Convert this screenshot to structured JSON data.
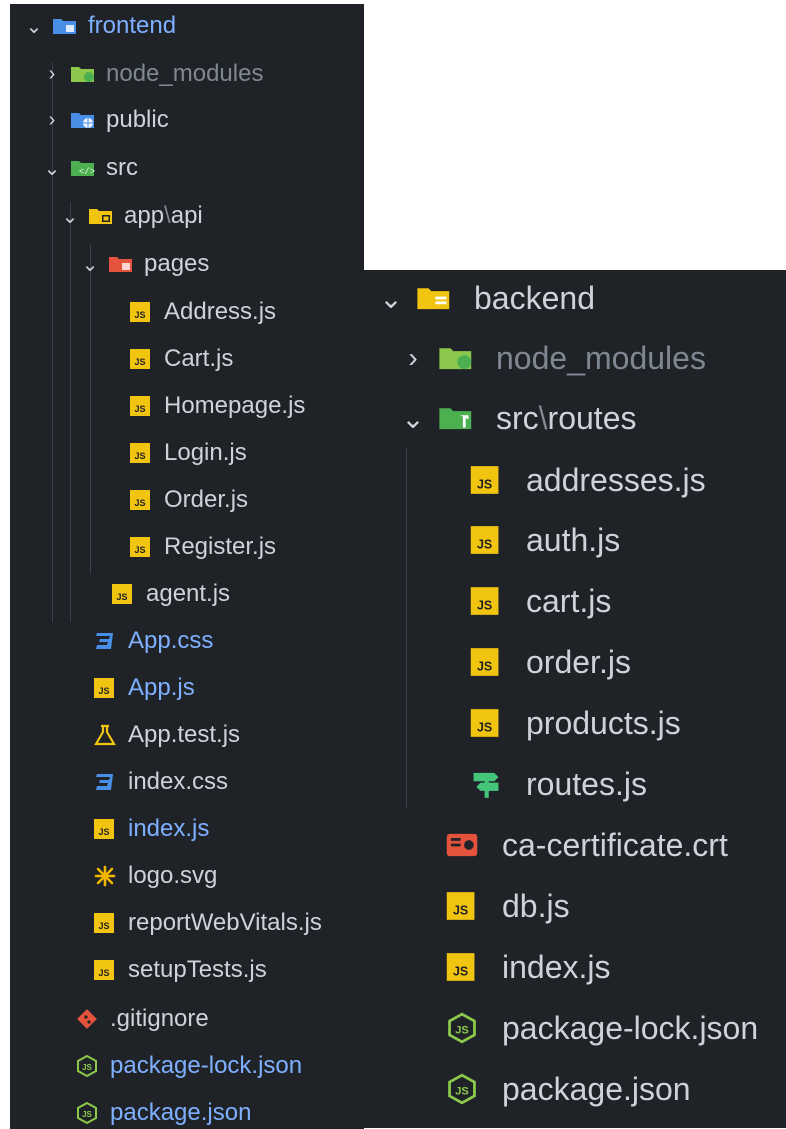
{
  "frontend": {
    "root": "frontend",
    "node_modules": "node_modules",
    "public": "public",
    "src": "src",
    "app_api": {
      "a": "app",
      "sep": "\\",
      "b": "api"
    },
    "pages": "pages",
    "page_files": [
      "Address.js",
      "Cart.js",
      "Homepage.js",
      "Login.js",
      "Order.js",
      "Register.js"
    ],
    "agent": "agent.js",
    "src_files": [
      "App.css",
      "App.js",
      "App.test.js",
      "index.css",
      "index.js",
      "logo.svg",
      "reportWebVitals.js",
      "setupTests.js"
    ],
    "root_files": [
      ".gitignore",
      "package-lock.json",
      "package.json"
    ]
  },
  "backend": {
    "root": "backend",
    "node_modules": "node_modules",
    "src_routes": {
      "a": "src",
      "sep": "\\",
      "b": "routes"
    },
    "route_files": [
      "addresses.js",
      "auth.js",
      "cart.js",
      "order.js",
      "products.js",
      "routes.js"
    ],
    "root_files": [
      "ca-certificate.crt",
      "db.js",
      "index.js",
      "package-lock.json",
      "package.json"
    ]
  },
  "colors": {
    "panel_bg": "#1f2328",
    "text": "#cfd3d9",
    "dim_text": "#7f8792",
    "js_yellow": "#f1c40f",
    "css_blue": "#4a8fe7",
    "git_red": "#e5533d",
    "node_green": "#8cc84b"
  }
}
